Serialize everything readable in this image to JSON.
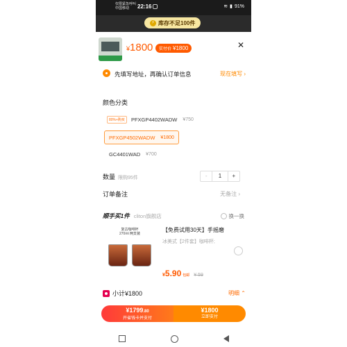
{
  "status": {
    "carrier_line1": "仅限紧急呼叫",
    "carrier_line2": "中国移动",
    "time": "22:16",
    "battery": "91%"
  },
  "stock_banner": "库存不足100件",
  "header": {
    "price": "1800",
    "currency": "¥",
    "pay_label": "实付价",
    "pay_price": "¥1800",
    "close": "✕"
  },
  "address": {
    "text": "先填写地址，再确认订单信息",
    "action": "现在填写"
  },
  "colors": {
    "title": "颜色分类",
    "options": [
      {
        "badge": "80%+购买",
        "name": "PFXGP4402WADW",
        "price": "¥750",
        "selected": false
      },
      {
        "badge": "",
        "name": "PFXGP4502WADW",
        "price": "¥1800",
        "selected": true
      },
      {
        "badge": "",
        "name": "GC4401WAD",
        "price": "¥700",
        "selected": false
      }
    ]
  },
  "quantity": {
    "label": "数量",
    "hint": "限购95件",
    "minus": "-",
    "value": "1",
    "plus": "+"
  },
  "remark": {
    "label": "订单备注",
    "value": "无备注"
  },
  "bundle": {
    "title": "顺手买1件",
    "shop": "cliton旗舰店",
    "swap": "换一换",
    "image_caption_1": "复古咖啡杯",
    "image_caption_2": "270ml 两支装",
    "product_title": "【免费试用30天】手摇磨",
    "product_sub": "冰美式【2件套】咖啡杯;",
    "price_currency": "¥",
    "price": "5.90",
    "price_tag": "包邮",
    "old_price": "¥ 59"
  },
  "subtotal": {
    "label": "小计¥1800",
    "detail": "明细"
  },
  "paybar": {
    "left_amount": "¥1799",
    "left_decimal": ".80",
    "left_label": "开省钱卡并支付",
    "right_amount": "¥1800",
    "right_label": "立即支付"
  },
  "accent": "#ff6a00"
}
